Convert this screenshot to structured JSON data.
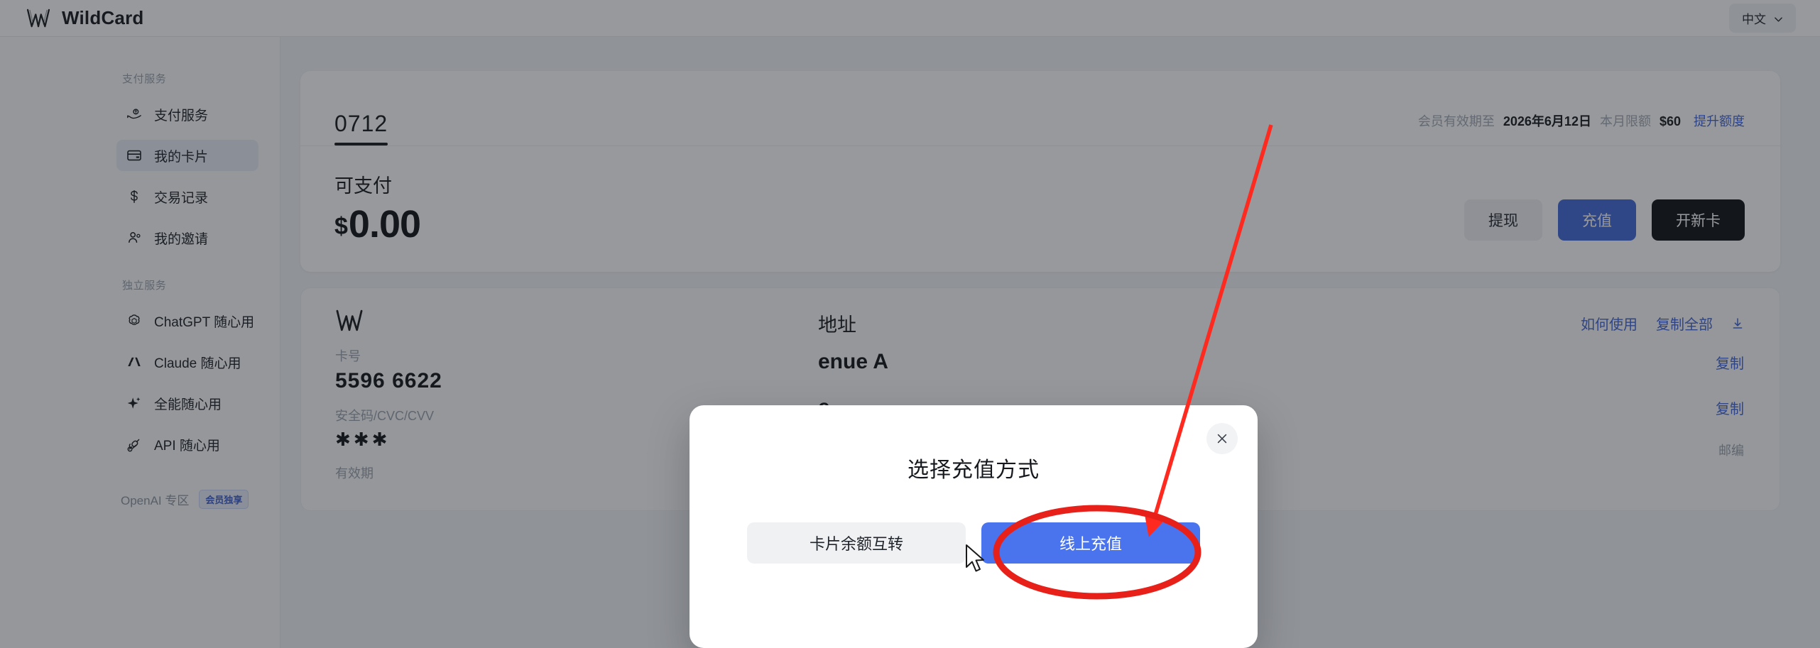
{
  "header": {
    "brand_name": "WildCard",
    "logo_icon": "wildcard-w-logo",
    "language": "中文",
    "language_chevron_icon": "chevron-down-icon"
  },
  "sidebar": {
    "groups": [
      {
        "title": "支付服务",
        "items": [
          {
            "label": "支付服务",
            "icon": "hand-coin-icon",
            "active": false
          },
          {
            "label": "我的卡片",
            "icon": "credit-card-icon",
            "active": true
          },
          {
            "label": "交易记录",
            "icon": "dollar-icon",
            "active": false
          },
          {
            "label": "我的邀请",
            "icon": "users-icon",
            "active": false
          }
        ]
      },
      {
        "title": "独立服务",
        "items": [
          {
            "label": "ChatGPT 随心用",
            "icon": "openai-icon",
            "active": false
          },
          {
            "label": "Claude 随心用",
            "icon": "anthropic-icon",
            "active": false
          },
          {
            "label": "全能随心用",
            "icon": "sparkle-icon",
            "active": false
          },
          {
            "label": "API 随心用",
            "icon": "plug-icon",
            "active": false
          }
        ]
      }
    ],
    "footer": {
      "label": "OpenAI 专区",
      "badge": "会员独享"
    }
  },
  "main": {
    "tab_label": "0712",
    "meta": {
      "membership_label": "会员有效期至",
      "membership_value": "2026年6月12日",
      "quota_label": "本月限额",
      "quota_value": "$60",
      "upgrade_link": "提升额度"
    },
    "balance": {
      "label": "可支付",
      "currency": "$",
      "amount": "0.00"
    },
    "actions": {
      "withdraw": "提现",
      "recharge": "充值",
      "new_card": "开新卡"
    },
    "card": {
      "logo_icon": "wildcard-w-logo",
      "number_label": "卡号",
      "number_value": "5596 6622 ",
      "cvc_label": "安全码/CVC/CVV",
      "cvc_value": "✱✱✱",
      "expiry_label": "有效期",
      "address_label": "地址",
      "how_to_use_link": "如何使用",
      "copy_all_link": "复制全部",
      "download_icon": "download-icon",
      "address_value": "enue A",
      "address_value_2": "e",
      "copy_link": "复制",
      "copy_link_2": "复制",
      "zip_label": "邮编"
    }
  },
  "modal": {
    "title": "选择充值方式",
    "close_icon": "close-icon",
    "option_transfer": "卡片余额互转",
    "option_online": "线上充值"
  },
  "annotation": {
    "arrow_color": "#ff2a1f",
    "ellipse_color": "#e8201a",
    "cursor_icon": "mouse-pointer-icon"
  },
  "colors": {
    "accent_blue": "#4068d8",
    "modal_primary": "#4a74ee",
    "link_blue": "#3f63d6",
    "dark_button": "#0c0e12",
    "active_sidebar": "#e9eef7"
  }
}
